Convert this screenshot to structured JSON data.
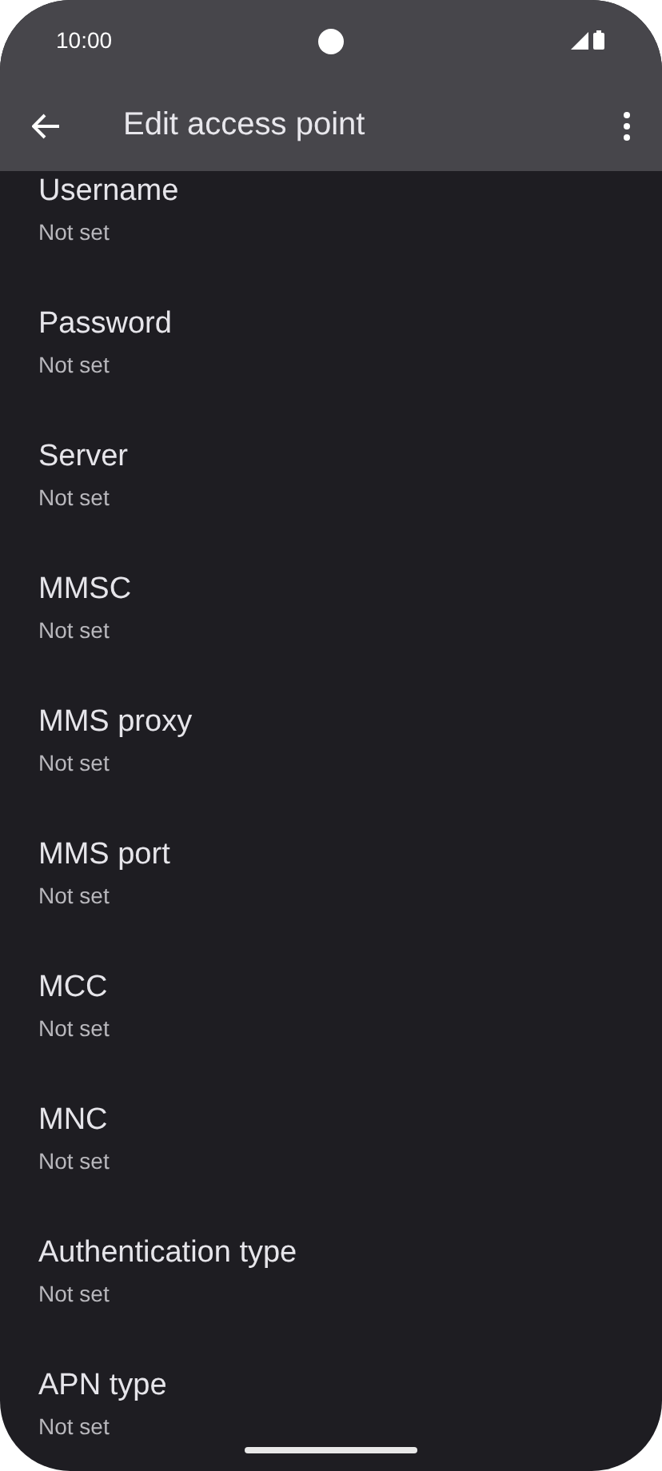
{
  "status_bar": {
    "time": "10:00"
  },
  "toolbar": {
    "title": "Edit access point"
  },
  "settings": [
    {
      "title": "Username",
      "summary": "Not set"
    },
    {
      "title": "Password",
      "summary": "Not set"
    },
    {
      "title": "Server",
      "summary": "Not set"
    },
    {
      "title": "MMSC",
      "summary": "Not set"
    },
    {
      "title": "MMS proxy",
      "summary": "Not set"
    },
    {
      "title": "MMS port",
      "summary": "Not set"
    },
    {
      "title": "MCC",
      "summary": "Not set"
    },
    {
      "title": "MNC",
      "summary": "Not set"
    },
    {
      "title": "Authentication type",
      "summary": "Not set"
    },
    {
      "title": "APN type",
      "summary": "Not set"
    }
  ]
}
